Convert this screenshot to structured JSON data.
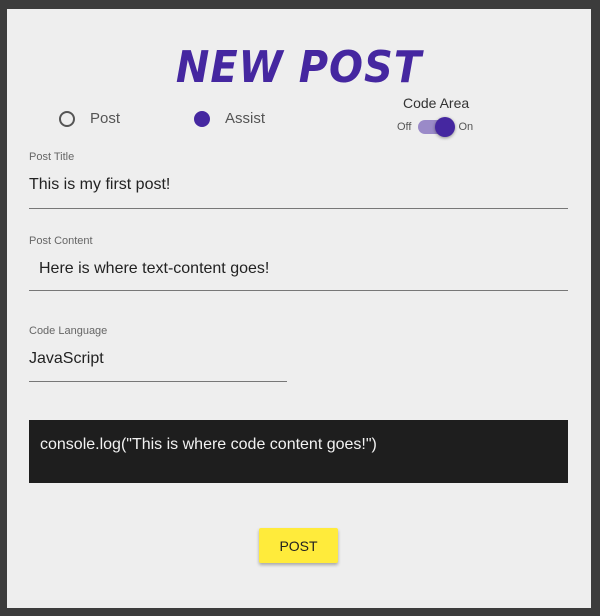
{
  "header": {
    "title": "NEW POST"
  },
  "post_type": {
    "options": [
      {
        "label": "Post",
        "selected": false
      },
      {
        "label": "Assist",
        "selected": true
      }
    ]
  },
  "code_area": {
    "label": "Code Area",
    "off_label": "Off",
    "on_label": "On",
    "enabled": true
  },
  "fields": {
    "title": {
      "label": "Post Title",
      "value": "This is my first post!"
    },
    "content": {
      "label": "Post Content",
      "value": "Here is where text-content goes!"
    },
    "language": {
      "label": "Code Language",
      "value": "JavaScript"
    }
  },
  "code": {
    "content": "console.log(\"This is where code content goes!\")"
  },
  "actions": {
    "post_label": "POST"
  },
  "colors": {
    "accent": "#4527a0",
    "button": "#ffeb3b",
    "code_bg": "#1e1e1e",
    "background": "#eeeeee"
  }
}
